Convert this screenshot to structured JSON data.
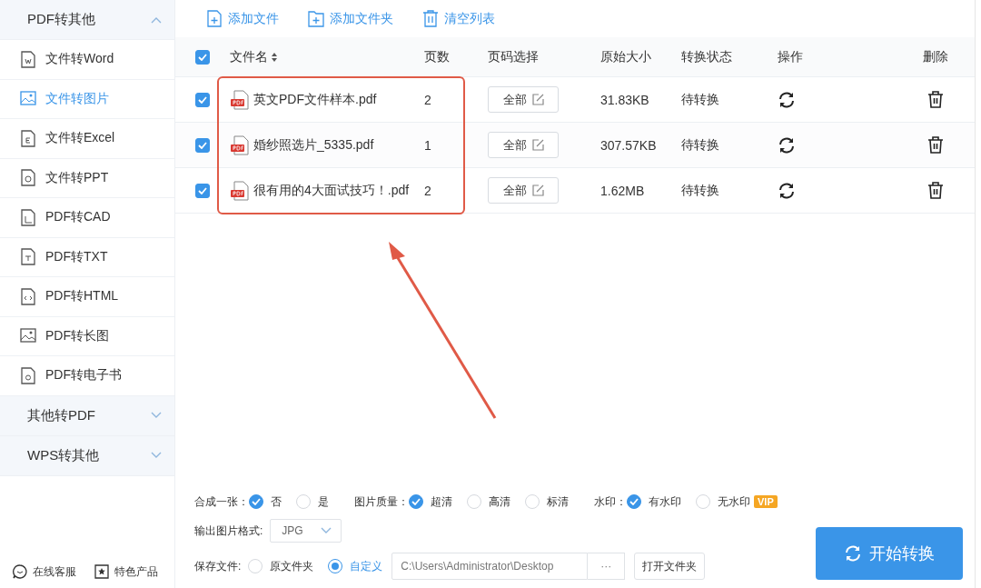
{
  "sidebar": {
    "groups": [
      {
        "label": "PDF转其他",
        "expanded": true,
        "items": [
          {
            "label": "文件转Word",
            "selected": false
          },
          {
            "label": "文件转图片",
            "selected": true
          },
          {
            "label": "文件转Excel",
            "selected": false
          },
          {
            "label": "文件转PPT",
            "selected": false
          },
          {
            "label": "PDF转CAD",
            "selected": false
          },
          {
            "label": "PDF转TXT",
            "selected": false
          },
          {
            "label": "PDF转HTML",
            "selected": false
          },
          {
            "label": "PDF转长图",
            "selected": false
          },
          {
            "label": "PDF转电子书",
            "selected": false
          }
        ]
      },
      {
        "label": "其他转PDF",
        "expanded": false
      },
      {
        "label": "WPS转其他",
        "expanded": false
      }
    ],
    "footer": [
      "在线客服",
      "特色产品"
    ]
  },
  "toolbar": [
    "添加文件",
    "添加文件夹",
    "清空列表"
  ],
  "table": {
    "all_checked": true,
    "columns": [
      "文件名",
      "页数",
      "页码选择",
      "原始大小",
      "转换状态",
      "操作",
      "删除"
    ],
    "rows": [
      {
        "checked": true,
        "name": "英文PDF文件样本.pdf",
        "pages": "2",
        "page_select": "全部",
        "size": "31.83KB",
        "status": "待转换"
      },
      {
        "checked": true,
        "name": "婚纱照选片_5335.pdf",
        "pages": "1",
        "page_select": "全部",
        "size": "307.57KB",
        "status": "待转换"
      },
      {
        "checked": true,
        "name": "很有用的4大面试技巧！.pdf",
        "pages": "2",
        "page_select": "全部",
        "size": "1.62MB",
        "status": "待转换"
      }
    ]
  },
  "options": {
    "choices": [
      {
        "label": "合成一张：",
        "options": [
          {
            "label": "否",
            "selected": true
          },
          {
            "label": "是",
            "selected": false
          }
        ]
      },
      {
        "label": "图片质量：",
        "options": [
          {
            "label": "超清",
            "selected": true
          },
          {
            "label": "高清",
            "selected": false
          },
          {
            "label": "标清",
            "selected": false
          }
        ]
      },
      {
        "label": "水印：",
        "options": [
          {
            "label": "有水印",
            "selected": true
          },
          {
            "label": "无水印",
            "selected": false,
            "badge": "VIP"
          }
        ]
      }
    ],
    "format": {
      "label": "输出图片格式:",
      "value": "JPG"
    },
    "save": {
      "label": "保存文件:",
      "options": [
        {
          "label": "原文件夹",
          "selected": false
        },
        {
          "label": "自定义",
          "selected": true
        }
      ],
      "path": "C:\\Users\\Administrator\\Desktop",
      "browse": "···",
      "open_folder": "打开文件夹"
    }
  },
  "start_button": "开始转换"
}
